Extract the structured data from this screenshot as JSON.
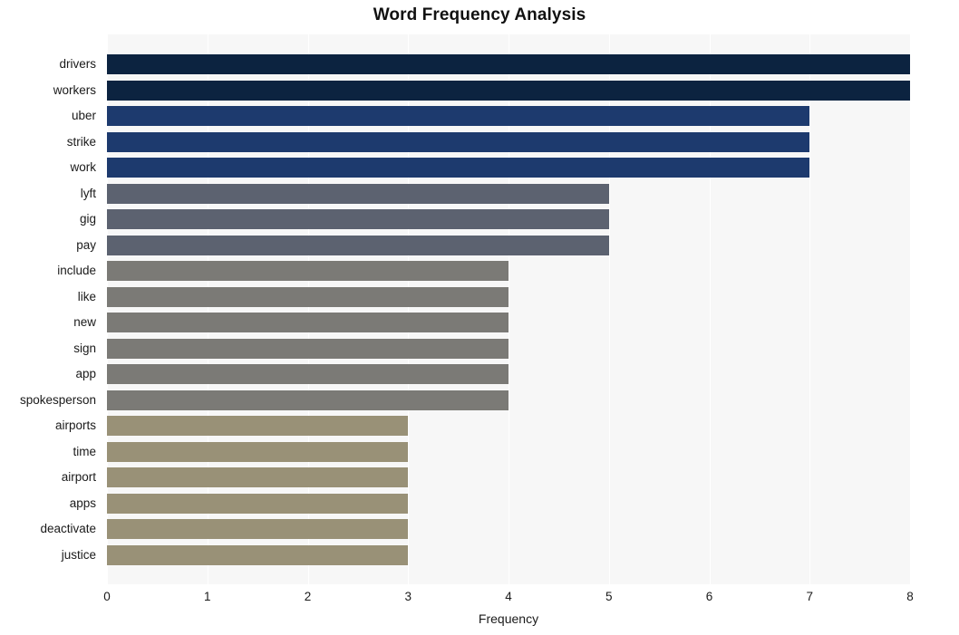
{
  "chart_data": {
    "type": "bar",
    "orientation": "horizontal",
    "title": "Word Frequency Analysis",
    "xlabel": "Frequency",
    "ylabel": "",
    "categories": [
      "drivers",
      "workers",
      "uber",
      "strike",
      "work",
      "lyft",
      "gig",
      "pay",
      "include",
      "like",
      "new",
      "sign",
      "app",
      "spokesperson",
      "airports",
      "time",
      "airport",
      "apps",
      "deactivate",
      "justice"
    ],
    "values": [
      8,
      8,
      7,
      7,
      7,
      5,
      5,
      5,
      4,
      4,
      4,
      4,
      4,
      4,
      3,
      3,
      3,
      3,
      3,
      3
    ],
    "bar_colors": [
      "#0c2340",
      "#0c2340",
      "#1d3a6e",
      "#1d3a6e",
      "#1d3a6e",
      "#5c6270",
      "#5c6270",
      "#5c6270",
      "#7b7a76",
      "#7b7a76",
      "#7b7a76",
      "#7b7a76",
      "#7b7a76",
      "#7b7a76",
      "#999177",
      "#999177",
      "#999177",
      "#999177",
      "#999177",
      "#999177"
    ],
    "xlim": [
      0,
      8
    ],
    "x_ticks": [
      "0",
      "1",
      "2",
      "3",
      "4",
      "5",
      "6",
      "7",
      "8"
    ],
    "x_tick_values": [
      0,
      1,
      2,
      3,
      4,
      5,
      6,
      7,
      8
    ],
    "grid": true,
    "grid_axis": "x",
    "grid_color": "#ffffff",
    "plot_background": "#f7f7f7",
    "figure_background": "#ffffff",
    "legend": null
  }
}
